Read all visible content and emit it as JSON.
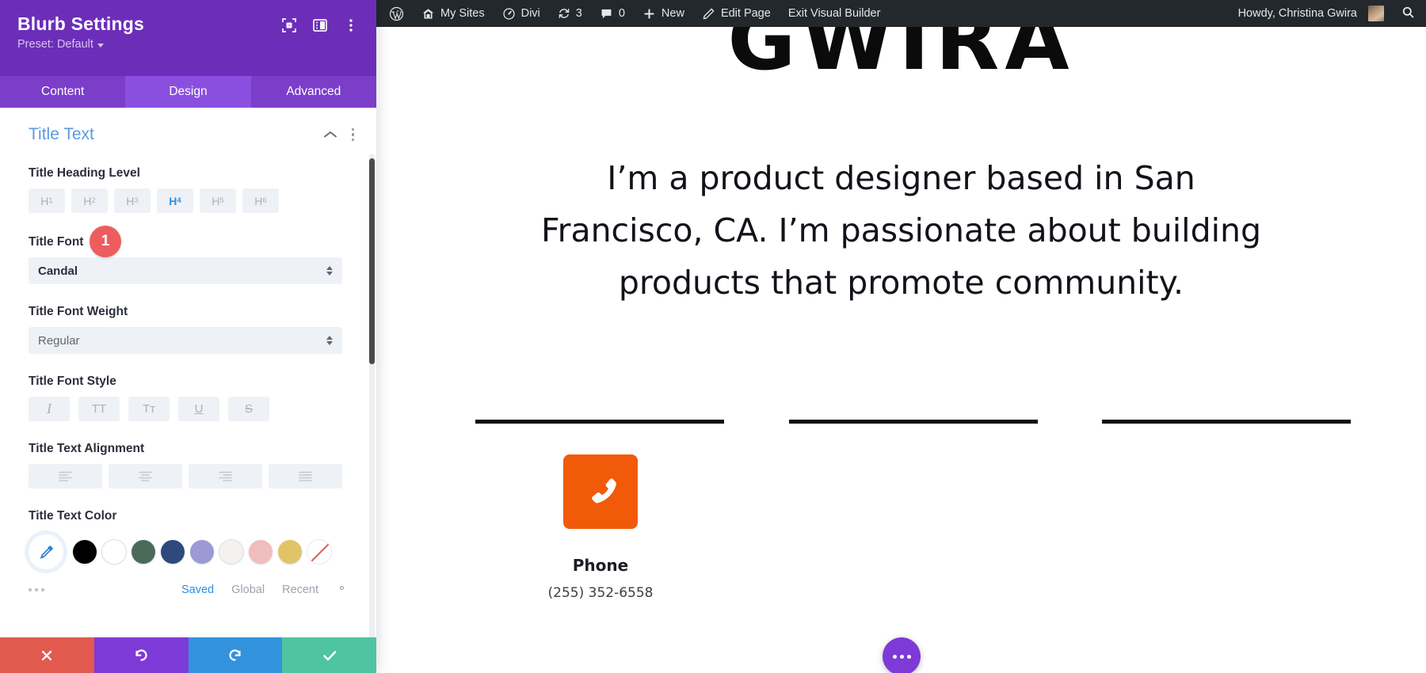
{
  "settings_panel": {
    "title": "Blurb Settings",
    "preset_label": "Preset: Default",
    "header_icons": [
      {
        "name": "focus-target-icon"
      },
      {
        "name": "layout-panel-icon"
      },
      {
        "name": "kebab-menu-icon"
      }
    ],
    "tabs": [
      {
        "label": "Content",
        "active": false
      },
      {
        "label": "Design",
        "active": true
      },
      {
        "label": "Advanced",
        "active": false
      }
    ],
    "section": {
      "title": "Title Text",
      "collapse_icon": "chevron-up-icon",
      "menu_icon": "kebab-menu-icon"
    },
    "fields": {
      "heading_level": {
        "label": "Title Heading Level",
        "options": [
          "H1",
          "H2",
          "H3",
          "H4",
          "H5",
          "H6"
        ],
        "selected": "H4"
      },
      "title_font": {
        "label": "Title Font",
        "badge": "1",
        "badge_color": "#ed5d5d",
        "value": "Candal"
      },
      "title_font_weight": {
        "label": "Title Font Weight",
        "value": "Regular"
      },
      "title_font_style": {
        "label": "Title Font Style",
        "options": [
          {
            "name": "italic-icon",
            "glyph": "I"
          },
          {
            "name": "uppercase-icon",
            "glyph": "TT"
          },
          {
            "name": "small-caps-icon",
            "glyph": "Tᴛ"
          },
          {
            "name": "underline-icon",
            "glyph": "U"
          },
          {
            "name": "strikethrough-icon",
            "glyph": "S"
          }
        ]
      },
      "title_text_alignment": {
        "label": "Title Text Alignment",
        "options": [
          {
            "name": "align-left-icon"
          },
          {
            "name": "align-center-icon"
          },
          {
            "name": "align-right-icon"
          },
          {
            "name": "align-justify-icon"
          }
        ]
      },
      "title_text_color": {
        "label": "Title Text Color",
        "picker_icon": "eyedropper-icon",
        "swatches": [
          "#000000",
          "#ffffff",
          "#4c6a5a",
          "#2e4a7d",
          "#9b9ad6",
          "#f4f1f0",
          "#f0bdbd",
          "#e2c468"
        ],
        "none_swatch": "transparent",
        "footer": {
          "more_icon": "ellipsis-icon",
          "links": [
            {
              "label": "Saved",
              "active": true
            },
            {
              "label": "Global",
              "active": false
            },
            {
              "label": "Recent",
              "active": false
            }
          ],
          "settings_icon": "gear-icon"
        }
      }
    },
    "footer_buttons": [
      {
        "name": "cancel-button",
        "icon": "close-icon",
        "color": "#e35a4e"
      },
      {
        "name": "undo-button",
        "icon": "undo-icon",
        "color": "#7e3ad6"
      },
      {
        "name": "redo-button",
        "icon": "redo-icon",
        "color": "#3293dc"
      },
      {
        "name": "save-button",
        "icon": "check-icon",
        "color": "#4fc4a0"
      }
    ]
  },
  "admin_bar": {
    "left_items": [
      {
        "label": "",
        "icon": "wordpress-logo-icon"
      },
      {
        "label": "My Sites",
        "icon": "home-icon"
      },
      {
        "label": "Divi",
        "icon": "dashboard-icon"
      },
      {
        "label": "3",
        "icon": "updates-icon"
      },
      {
        "label": "0",
        "icon": "comments-icon"
      },
      {
        "label": "New",
        "icon": "plus-icon"
      },
      {
        "label": "Edit Page",
        "icon": "pencil-icon"
      },
      {
        "label": "Exit Visual Builder",
        "icon": ""
      }
    ],
    "greeting": "Howdy, Christina Gwira",
    "avatar_name": "user-avatar",
    "search_icon": "search-icon"
  },
  "page": {
    "wordmark": "GWIRA",
    "intro_text": "I’m a product designer based in San Francisco, CA. I’m passionate about building products that promote community.",
    "blurb": {
      "icon_name": "phone-icon",
      "icon_color": "#f15a08",
      "title": "Phone",
      "subtitle": "(255) 352-6558"
    },
    "fab": {
      "name": "page-settings-fab",
      "icon": "ellipsis-icon",
      "color": "#7e3ad6"
    }
  }
}
